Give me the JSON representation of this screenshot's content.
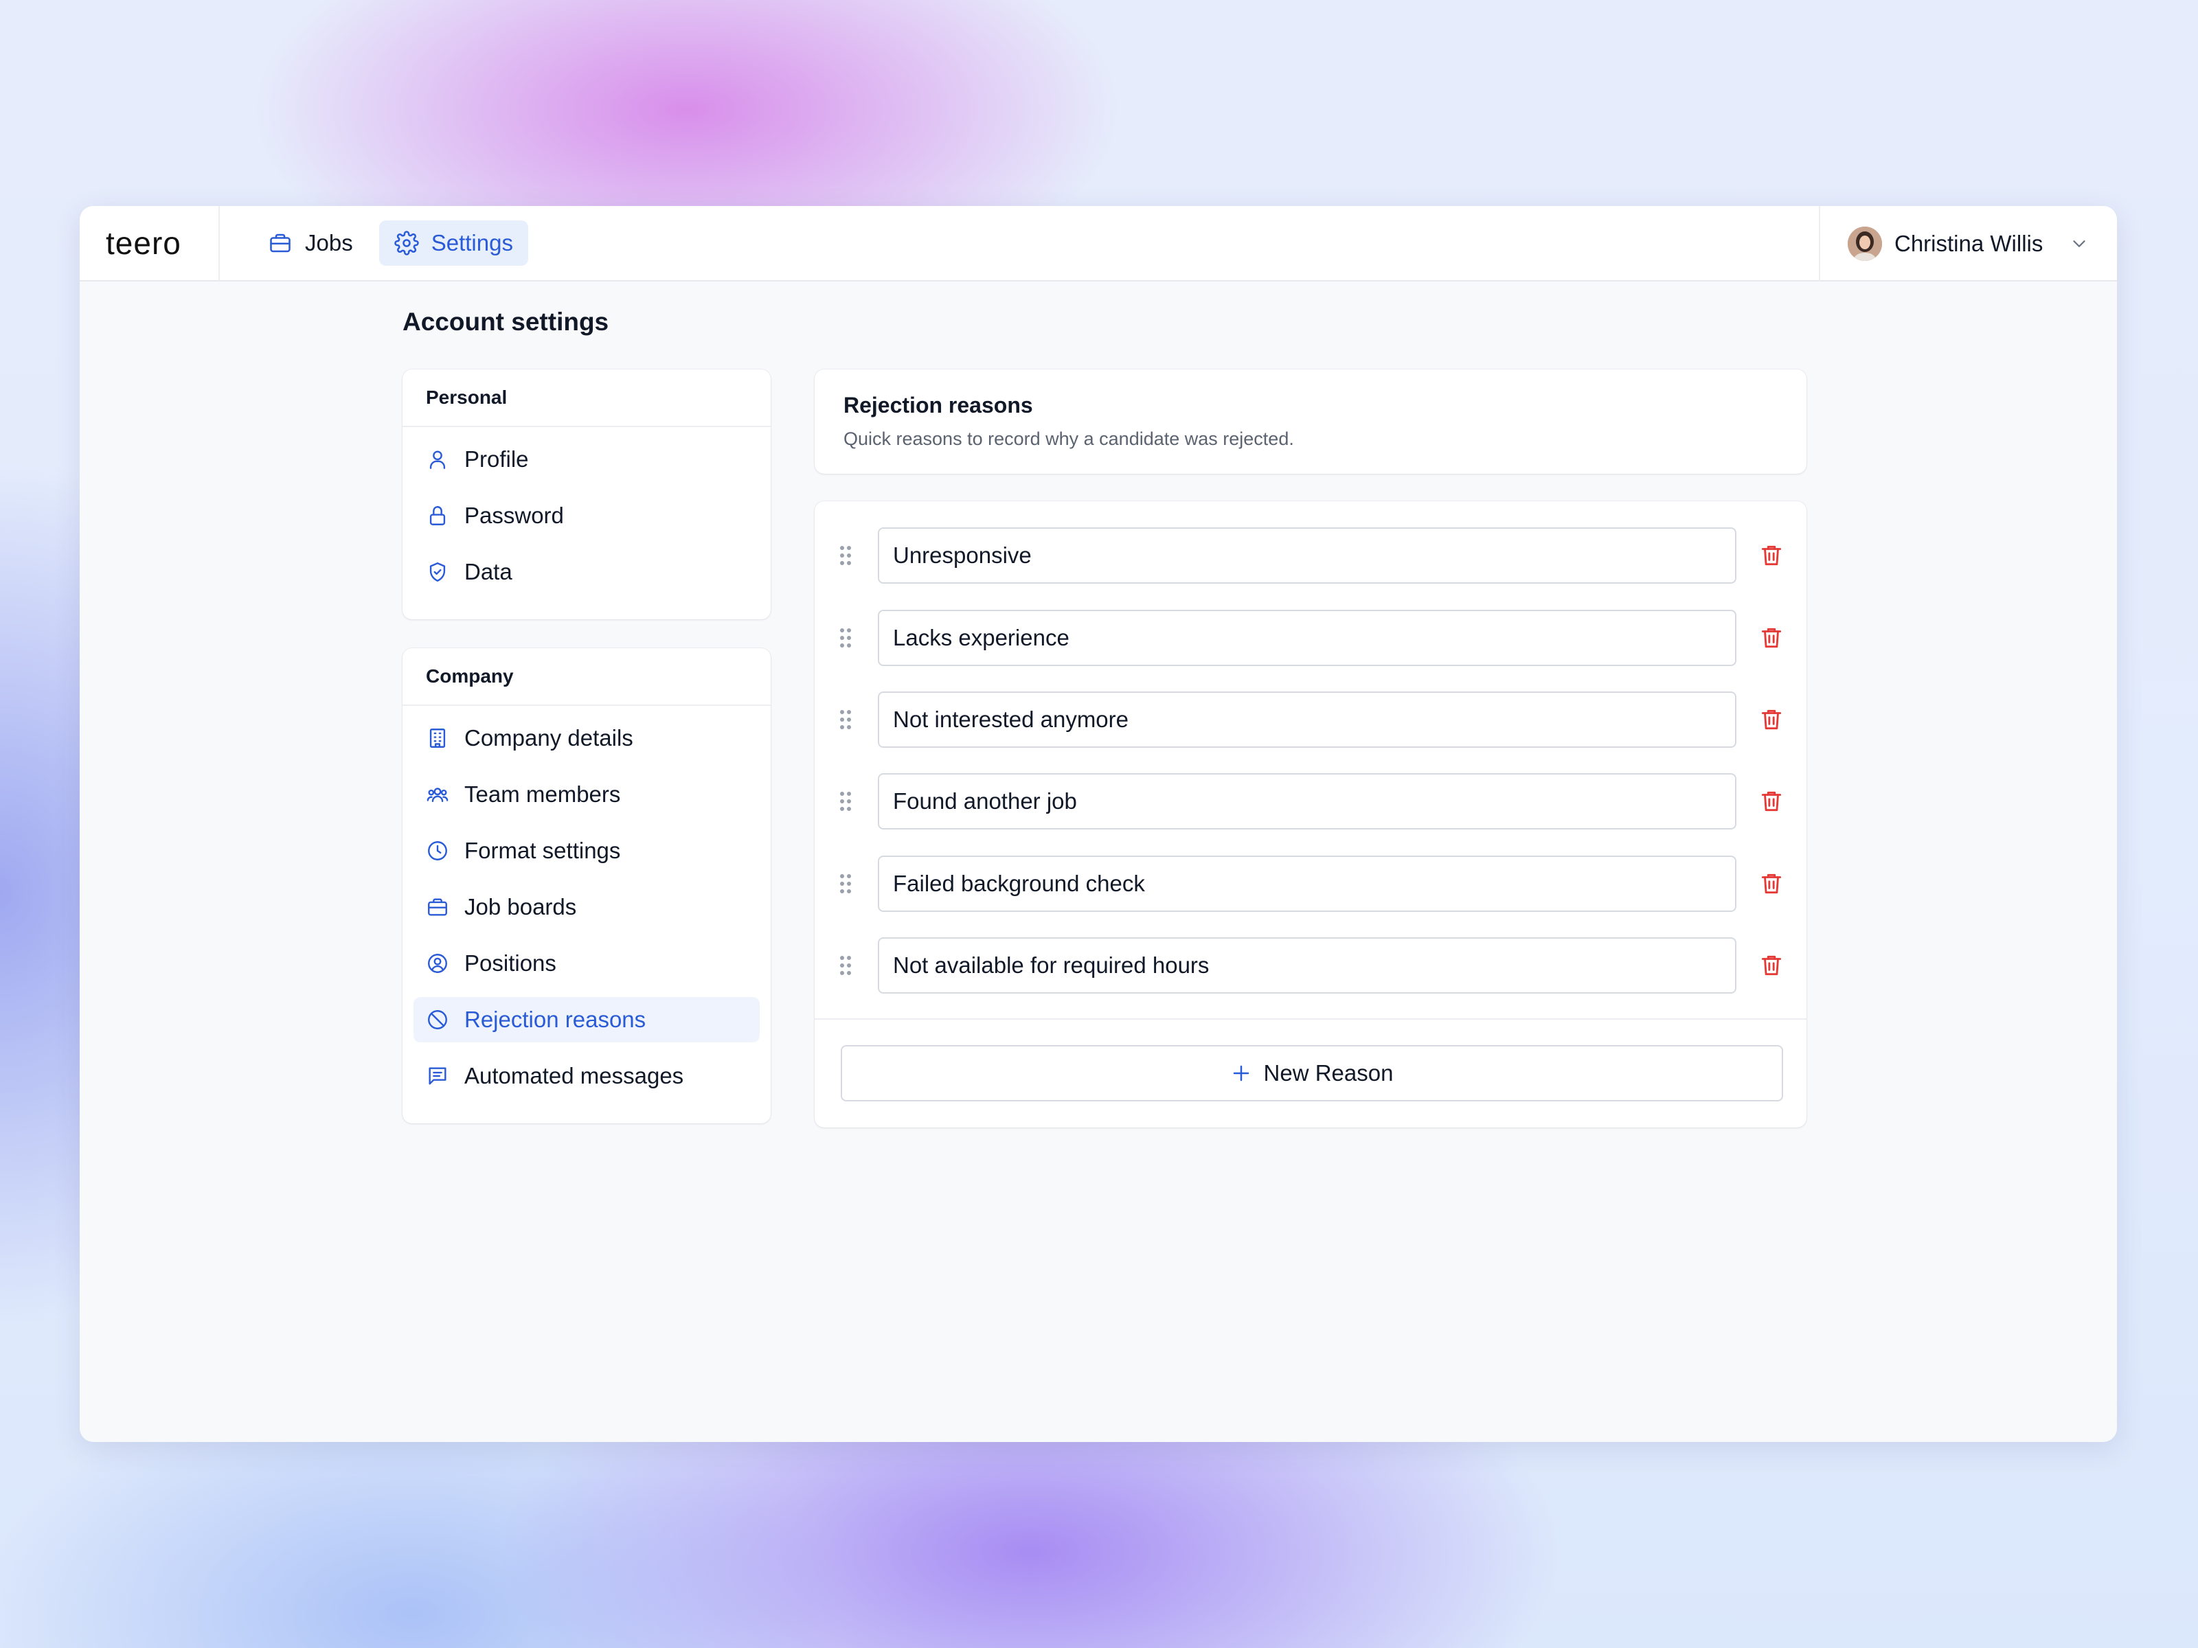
{
  "app": {
    "logo": "teero"
  },
  "nav": {
    "jobs": "Jobs",
    "settings": "Settings"
  },
  "user": {
    "name": "Christina Willis"
  },
  "page": {
    "title": "Account settings"
  },
  "sidebar": {
    "personal": {
      "heading": "Personal",
      "items": [
        {
          "label": "Profile",
          "icon": "user-icon"
        },
        {
          "label": "Password",
          "icon": "lock-icon"
        },
        {
          "label": "Data",
          "icon": "shield-icon"
        }
      ]
    },
    "company": {
      "heading": "Company",
      "items": [
        {
          "label": "Company details",
          "icon": "building-icon"
        },
        {
          "label": "Team members",
          "icon": "users-icon"
        },
        {
          "label": "Format settings",
          "icon": "clock-icon"
        },
        {
          "label": "Job boards",
          "icon": "briefcase-icon"
        },
        {
          "label": "Positions",
          "icon": "user-circle-icon"
        },
        {
          "label": "Rejection reasons",
          "icon": "ban-icon",
          "active": true
        },
        {
          "label": "Automated messages",
          "icon": "message-icon"
        }
      ]
    }
  },
  "rejection": {
    "title": "Rejection reasons",
    "subtitle": "Quick reasons to record why a candidate was rejected.",
    "reasons": [
      "Unresponsive",
      "Lacks experience",
      "Not interested anymore",
      "Found another job",
      "Failed background check",
      "Not available for required hours"
    ],
    "new_button": "New Reason"
  },
  "colors": {
    "accent": "#2a5bd7",
    "danger": "#e53935"
  }
}
